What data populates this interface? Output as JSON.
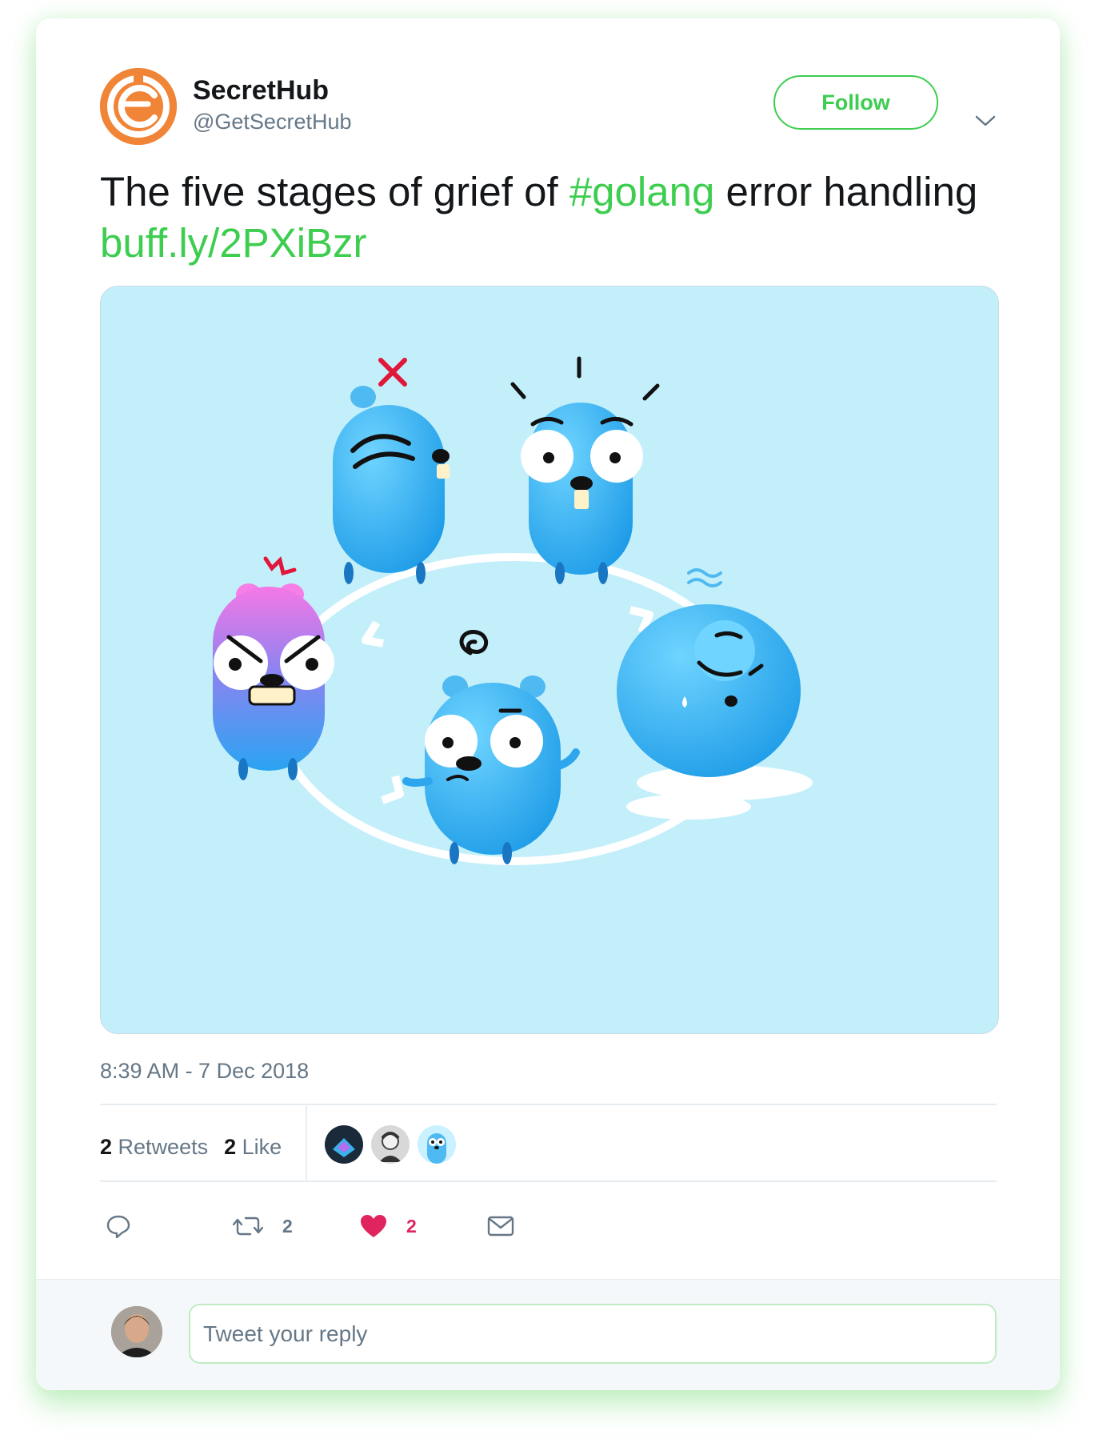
{
  "colors": {
    "accent": "#3dcd4f",
    "like": "#e0245e",
    "secondary_text": "#657786",
    "brand": "#f08437",
    "media_bg": "#c3effb"
  },
  "author": {
    "name": "SecretHub",
    "handle": "@GetSecretHub",
    "avatar_icon": "secrethub-logo"
  },
  "follow_label": "Follow",
  "tweet": {
    "text_1": "The five stages of grief of ",
    "hashtag": "#golang",
    "text_2": " error handling ",
    "link": "buff.ly/2PXiBzr"
  },
  "timestamp": "8:39 AM - 7 Dec 2018",
  "stats": {
    "retweets_count": "2",
    "retweets_label": "Retweets",
    "likes_count": "2",
    "likes_label": "Like"
  },
  "likers": [
    "liker-avatar-1",
    "liker-avatar-2",
    "liker-avatar-3"
  ],
  "actions": {
    "reply_icon": "speech-bubble-icon",
    "retweet_icon": "retweet-icon",
    "retweet_count": "2",
    "like_icon": "heart-icon",
    "like_count": "2",
    "message_icon": "envelope-icon"
  },
  "reply": {
    "placeholder": "Tweet your reply"
  }
}
